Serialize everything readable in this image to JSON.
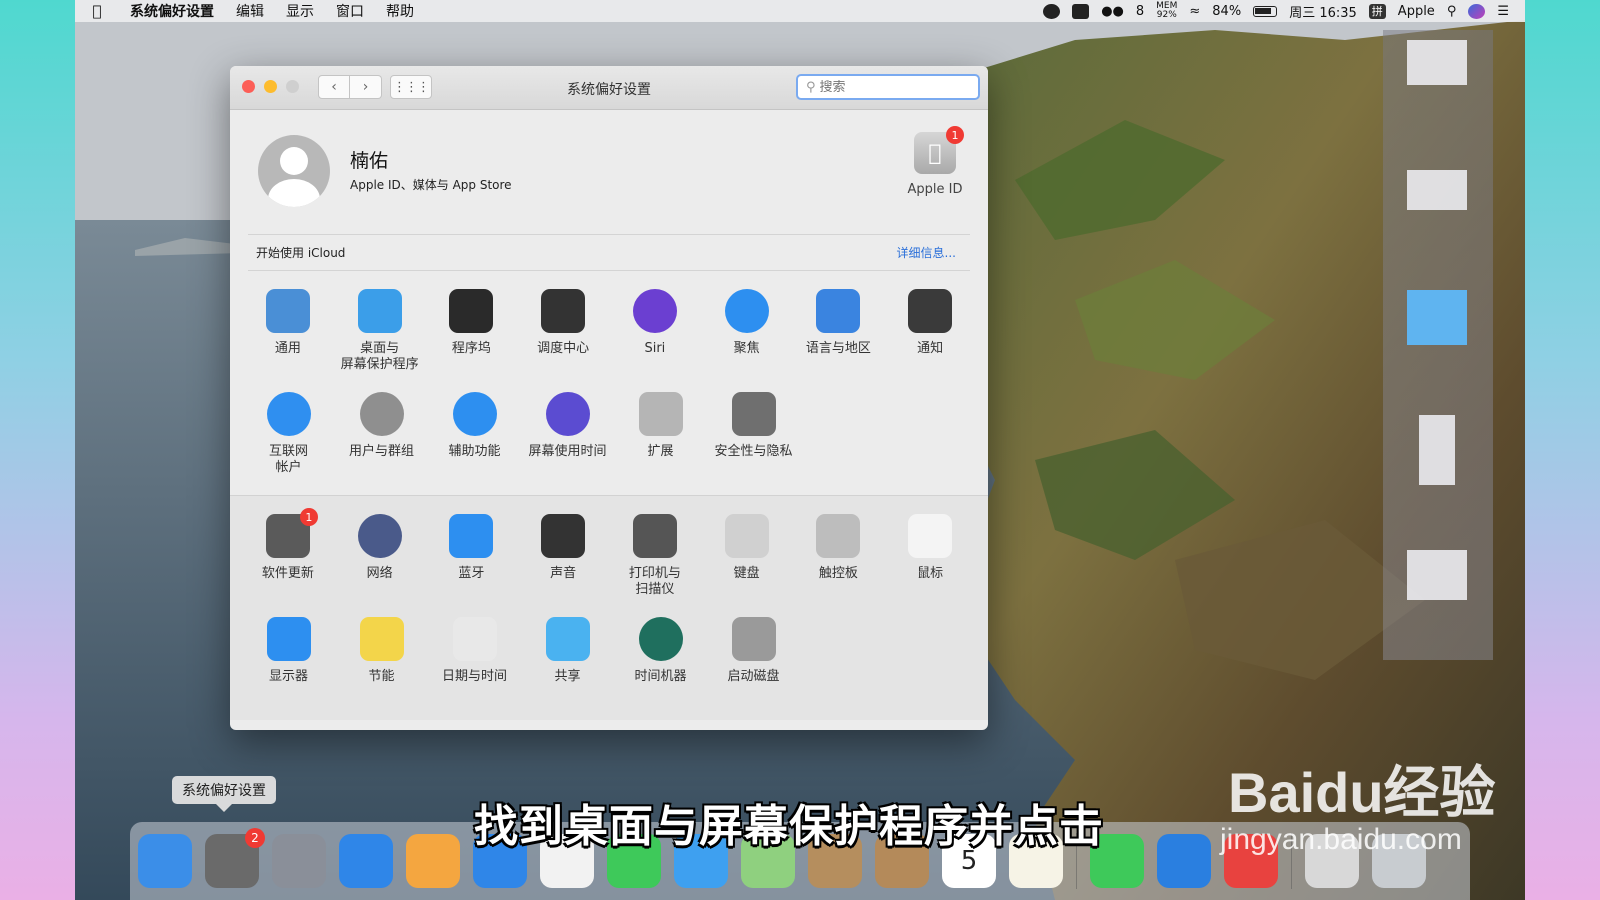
{
  "menubar": {
    "app_name": "系统偏好设置",
    "menus": [
      "编辑",
      "显示",
      "窗口",
      "帮助"
    ],
    "wechat_count": "8",
    "mem_label": "MEM",
    "mem_value": "92%",
    "battery": "84%",
    "clock": "周三 16:35",
    "input_method": "拼",
    "user": "Apple"
  },
  "window": {
    "title": "系统偏好设置",
    "search_placeholder": "搜索",
    "account": {
      "name": "楠佑",
      "subtitle": "Apple ID、媒体与 App Store",
      "apple_id_label": "Apple ID",
      "apple_id_badge": "1"
    },
    "icloud": {
      "prompt": "开始使用 iCloud",
      "details": "详细信息..."
    },
    "section1": [
      {
        "label": "通用",
        "icon": "general-icon",
        "color": "#4a8fd6"
      },
      {
        "label": "桌面与\n屏幕保护程序",
        "icon": "desktop-screensaver-icon",
        "color": "#3b9ee9"
      },
      {
        "label": "程序坞",
        "icon": "dock-icon",
        "color": "#2a2a2a"
      },
      {
        "label": "调度中心",
        "icon": "mission-control-icon",
        "color": "#333333"
      },
      {
        "label": "Siri",
        "icon": "siri-icon",
        "color": "#6b3fd1"
      },
      {
        "label": "聚焦",
        "icon": "spotlight-icon",
        "color": "#2d8ff0"
      },
      {
        "label": "语言与地区",
        "icon": "language-region-icon",
        "color": "#3a84e0"
      },
      {
        "label": "通知",
        "icon": "notifications-icon",
        "color": "#3a3a3a"
      },
      {
        "label": "互联网\n帐户",
        "icon": "internet-accounts-icon",
        "color": "#2f8ff0"
      },
      {
        "label": "用户与群组",
        "icon": "users-groups-icon",
        "color": "#8f8f8f"
      },
      {
        "label": "辅助功能",
        "icon": "accessibility-icon",
        "color": "#2d8ff0"
      },
      {
        "label": "屏幕使用时间",
        "icon": "screen-time-icon",
        "color": "#5b4cd1"
      },
      {
        "label": "扩展",
        "icon": "extensions-icon",
        "color": "#b5b5b5"
      },
      {
        "label": "安全性与隐私",
        "icon": "security-privacy-icon",
        "color": "#6f6f6f"
      }
    ],
    "section2": [
      {
        "label": "软件更新",
        "icon": "software-update-icon",
        "color": "#5a5a5a",
        "badge": "1"
      },
      {
        "label": "网络",
        "icon": "network-icon",
        "color": "#4a5a8a"
      },
      {
        "label": "蓝牙",
        "icon": "bluetooth-icon",
        "color": "#2d8ff0"
      },
      {
        "label": "声音",
        "icon": "sound-icon",
        "color": "#333333"
      },
      {
        "label": "打印机与\n扫描仪",
        "icon": "printers-scanners-icon",
        "color": "#555555"
      },
      {
        "label": "键盘",
        "icon": "keyboard-icon",
        "color": "#d0d0d0"
      },
      {
        "label": "触控板",
        "icon": "trackpad-icon",
        "color": "#bdbdbd"
      },
      {
        "label": "鼠标",
        "icon": "mouse-icon",
        "color": "#f4f4f4"
      },
      {
        "label": "显示器",
        "icon": "displays-icon",
        "color": "#2d8ff0"
      },
      {
        "label": "节能",
        "icon": "energy-saver-icon",
        "color": "#f3d54a"
      },
      {
        "label": "日期与时间",
        "icon": "date-time-icon",
        "color": "#e8e8e8"
      },
      {
        "label": "共享",
        "icon": "sharing-icon",
        "color": "#4ab2f0"
      },
      {
        "label": "时间机器",
        "icon": "time-machine-icon",
        "color": "#1f6f5e"
      },
      {
        "label": "启动磁盘",
        "icon": "startup-disk-icon",
        "color": "#9a9a9a"
      }
    ]
  },
  "dock": {
    "tooltip": "系统偏好设置",
    "prefs_badge": "2",
    "calendar_day": "5",
    "apps": [
      {
        "name": "finder-icon",
        "color": "#3b8ee8"
      },
      {
        "name": "system-preferences-icon",
        "color": "#6a6a6a"
      },
      {
        "name": "launchpad-icon",
        "color": "#8a8f99"
      },
      {
        "name": "safari-icon",
        "color": "#2f86e8"
      },
      {
        "name": "photos-icon",
        "color": "#f4a640"
      },
      {
        "name": "app-store-icon",
        "color": "#2f86e8"
      },
      {
        "name": "music-icon",
        "color": "#f2f2f2"
      },
      {
        "name": "facetime-icon",
        "color": "#3ec95a"
      },
      {
        "name": "messages-icon",
        "color": "#3ea0f0"
      },
      {
        "name": "maps-icon",
        "color": "#8fd07f"
      },
      {
        "name": "mail-stamp-icon",
        "color": "#b58e5e"
      },
      {
        "name": "contacts-icon",
        "color": "#b48a5a"
      },
      {
        "name": "calendar-icon",
        "color": "#ffffff"
      },
      {
        "name": "notes-icon",
        "color": "#f6f3e6"
      },
      {
        "name": "wechat-icon",
        "color": "#3ec95a"
      },
      {
        "name": "qq-browser-icon",
        "color": "#2a7fe0"
      },
      {
        "name": "wps-icon",
        "color": "#e8423f"
      },
      {
        "name": "downloads-stack-icon",
        "color": "#d8d8d8"
      },
      {
        "name": "trash-icon",
        "color": "#c8ccd0"
      }
    ]
  },
  "overlay": {
    "subtitle": "找到桌面与屏幕保护程序并点击",
    "watermark_main": "Baidu经验",
    "watermark_sub": "jingyan.baidu.com"
  }
}
